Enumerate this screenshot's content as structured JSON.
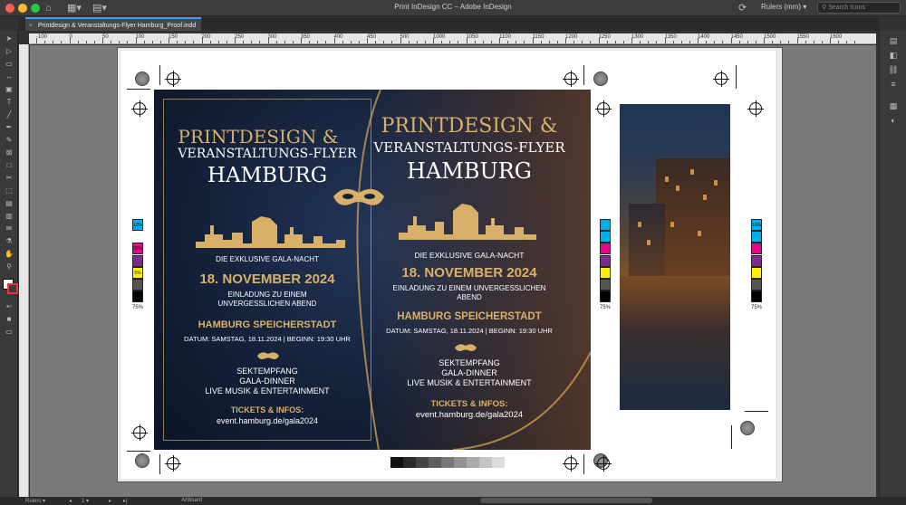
{
  "window": {
    "title": "Print InDesign CC – Adobe InDesign",
    "workspace": "Rulers (mm)",
    "search_placeholder": "Search Icons"
  },
  "document": {
    "tab_label": "Printdesign & Veranstaltungs-Flyer Hamburg_Proof.indd"
  },
  "ruler": {
    "labels": [
      "-100",
      "0",
      "50",
      "100",
      "150",
      "200",
      "250",
      "300",
      "350",
      "400",
      "450",
      "500",
      "1000",
      "1050",
      "1100",
      "1150",
      "1200",
      "1250",
      "1300",
      "1350",
      "1400",
      "1450",
      "1500",
      "1550",
      "1600"
    ]
  },
  "flyer": {
    "title_line1": "PRINTDESIGN &",
    "title_line2": "VERANSTALTUNGS-FLYER",
    "title_line3": "HAMBURG",
    "event_type": "DIE EXKLUSIVE GALA-NACHT",
    "date": "18. NOVEMBER 2024",
    "invite_line1": "EINLADUNG ZU EINEM",
    "invite_line2": "UNVERGESSLICHEN ABEND",
    "invite_full": "EINLADUNG ZU EINEM UNVERGESSLICHEN",
    "invite_rest": "ABEND",
    "venue": "HAMBURG SPEICHERSTADT",
    "datetime": "DATUM: SAMSTAG, 18.11.2024 | BEGINN: 19:30 UHR",
    "program": [
      "SEKTEMPFANG",
      "GALA-DINNER",
      "LIVE MUSIK & ENTERTAINMENT"
    ],
    "tickets_label": "TICKETS & INFOS:",
    "url": "event.hamburg.de/gala2024"
  },
  "color_bars": {
    "labels": [
      "10%",
      "20%",
      "5%"
    ],
    "tint_label": "75%"
  },
  "status": {
    "view_mode": "Rulers",
    "page_number": "1",
    "layer": "Artboard"
  },
  "colors": {
    "gold": "#d9b06a",
    "navy": "#14213a",
    "accent": "#3aa0ff"
  }
}
